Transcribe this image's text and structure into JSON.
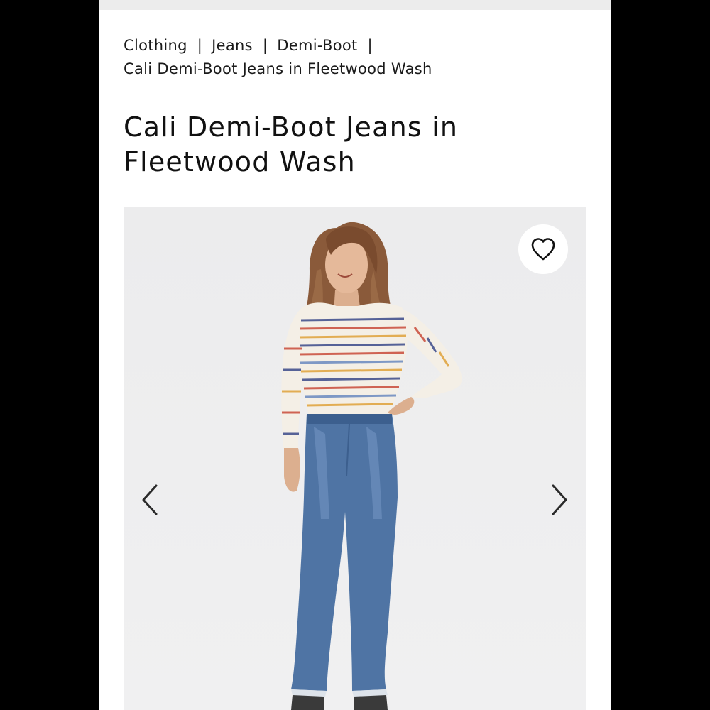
{
  "breadcrumb": {
    "items": [
      "Clothing",
      "Jeans",
      "Demi-Boot"
    ],
    "separator": "|",
    "current": "Cali Demi-Boot Jeans in Fleetwood Wash"
  },
  "product": {
    "title": "Cali Demi-Boot Jeans in Fleetwood Wash"
  },
  "gallery": {
    "favorite_icon": "heart-outline-icon",
    "prev_icon": "chevron-left-icon",
    "next_icon": "chevron-right-icon"
  }
}
